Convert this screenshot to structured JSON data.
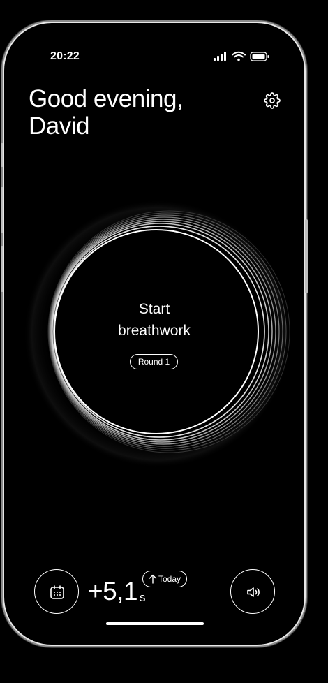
{
  "status_bar": {
    "time": "20:22",
    "icons": [
      "cellular-signal-icon",
      "wifi-icon",
      "battery-icon"
    ]
  },
  "greeting": {
    "line1": "Good evening,",
    "line2": "David"
  },
  "header": {
    "settings_icon": "gear-icon"
  },
  "breathwork": {
    "label_line1": "Start",
    "label_line2": "breathwork",
    "round_label": "Round 1"
  },
  "footer": {
    "calendar_icon": "calendar-icon",
    "delta_value": "+5,1",
    "delta_unit": "s",
    "trend_label": "Today",
    "trend_icon": "arrow-up-icon",
    "sound_icon": "speaker-icon"
  },
  "colors": {
    "background": "#000000",
    "foreground": "#ffffff"
  }
}
